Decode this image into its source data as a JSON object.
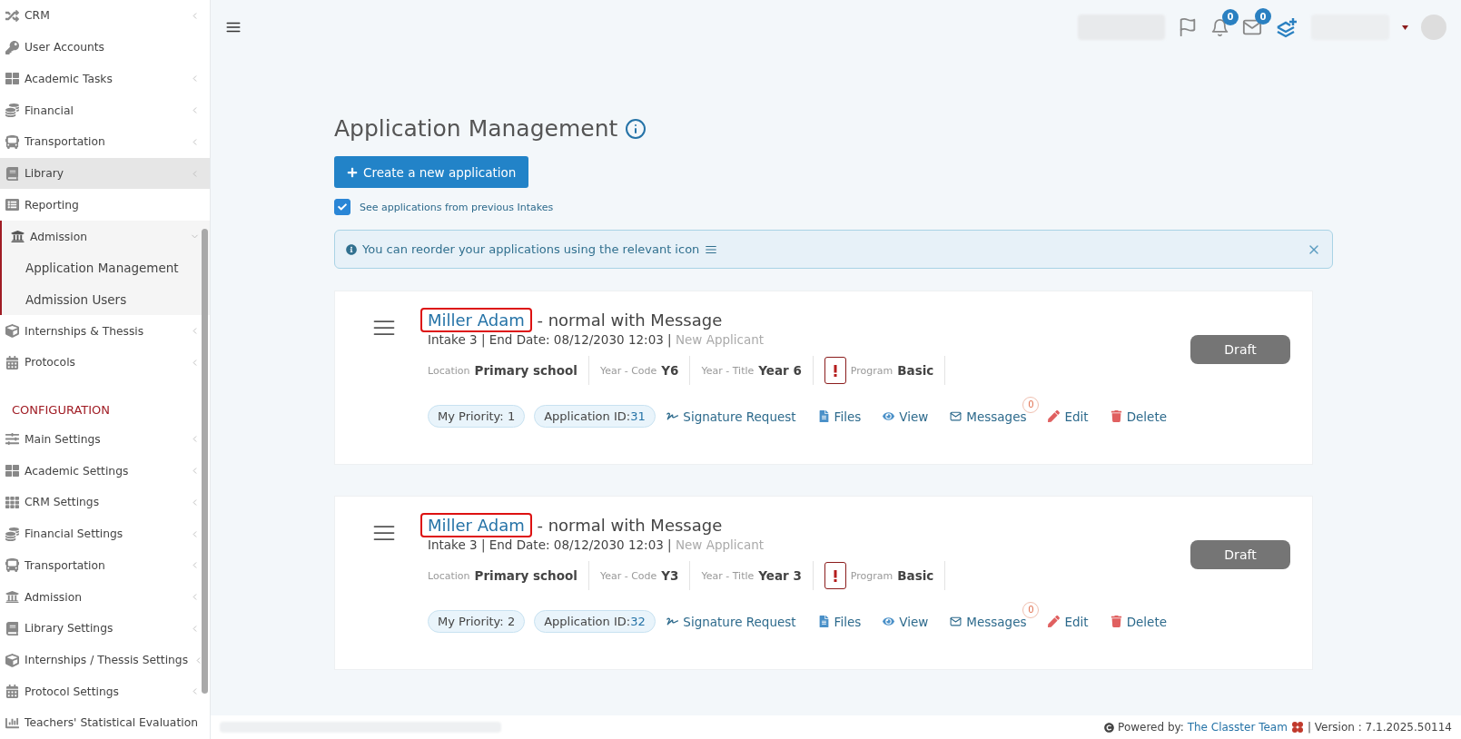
{
  "sidebar": {
    "items": [
      {
        "label": "CRM",
        "chevron": true,
        "selected": false,
        "expanded": false
      },
      {
        "label": "User Accounts",
        "chevron": false,
        "selected": false,
        "expanded": false
      },
      {
        "label": "Academic Tasks",
        "chevron": true,
        "selected": false,
        "expanded": false
      },
      {
        "label": "Financial",
        "chevron": true,
        "selected": false,
        "expanded": false
      },
      {
        "label": "Transportation",
        "chevron": true,
        "selected": false,
        "expanded": false
      },
      {
        "label": "Library",
        "chevron": true,
        "selected": true,
        "expanded": false
      },
      {
        "label": "Reporting",
        "chevron": false,
        "selected": false,
        "expanded": false
      },
      {
        "label": "Admission",
        "chevron": true,
        "selected": false,
        "expanded": true,
        "children": [
          {
            "label": "Application Management",
            "selected": false
          },
          {
            "label": "Admission Users",
            "selected": false
          }
        ]
      },
      {
        "label": "Internships & Thessis",
        "chevron": true,
        "selected": false,
        "expanded": false
      },
      {
        "label": "Protocols",
        "chevron": true,
        "selected": false,
        "expanded": false
      }
    ],
    "section_title": "CONFIGURATION",
    "config_items": [
      {
        "label": "Main Settings",
        "chevron": true
      },
      {
        "label": "Academic Settings",
        "chevron": true
      },
      {
        "label": "CRM Settings",
        "chevron": true
      },
      {
        "label": "Financial Settings",
        "chevron": true
      },
      {
        "label": "Transportation",
        "chevron": true
      },
      {
        "label": "Admission",
        "chevron": true
      },
      {
        "label": "Library Settings",
        "chevron": true
      },
      {
        "label": "Internships / Thessis Settings",
        "chevron": true
      },
      {
        "label": "Protocol Settings",
        "chevron": true
      },
      {
        "label": "Teachers' Statistical Evaluation",
        "chevron": false
      }
    ]
  },
  "header": {
    "notifications": "0",
    "messages": "0"
  },
  "page": {
    "title": "Application Management",
    "create_button": "Create a new application",
    "previous_intakes": {
      "label": "See applications from previous Intakes",
      "checked": true
    },
    "alert": "You can reorder your applications using the relevant icon"
  },
  "applications": [
    {
      "name": "Miller Adam",
      "title": " - normal with Message",
      "intake": "Intake 3 | End Date: 08/12/2030 12:03 | ",
      "type": "New Applicant",
      "fields": [
        {
          "label": "Location",
          "value": "Primary school"
        },
        {
          "label": "Year - Code",
          "value": "Y6"
        },
        {
          "label": "Year - Title",
          "value": "Year 6"
        },
        {
          "label": "Program",
          "value": "Basic",
          "warning": true
        }
      ],
      "status": "Draft",
      "priority": "My Priority: 1",
      "app_id_label": "Application ID: ",
      "app_id": "31",
      "actions": [
        "Signature Request",
        "Files",
        "View",
        "Messages",
        "Edit",
        "Delete"
      ],
      "message_count": "0"
    },
    {
      "name": "Miller Adam",
      "title": " - normal with Message",
      "intake": "Intake 3 | End Date: 08/12/2030 12:03 | ",
      "type": "New Applicant",
      "fields": [
        {
          "label": "Location",
          "value": "Primary school"
        },
        {
          "label": "Year - Code",
          "value": "Y3"
        },
        {
          "label": "Year - Title",
          "value": "Year 3"
        },
        {
          "label": "Program",
          "value": "Basic",
          "warning": true
        }
      ],
      "status": "Draft",
      "priority": "My Priority: 2",
      "app_id_label": "Application ID: ",
      "app_id": "32",
      "actions": [
        "Signature Request",
        "Files",
        "View",
        "Messages",
        "Edit",
        "Delete"
      ],
      "message_count": "0"
    }
  ],
  "footer": {
    "powered": "Powered by: ",
    "team": "The Classter Team",
    "version": "| Version : 7.1.2025.50114"
  }
}
